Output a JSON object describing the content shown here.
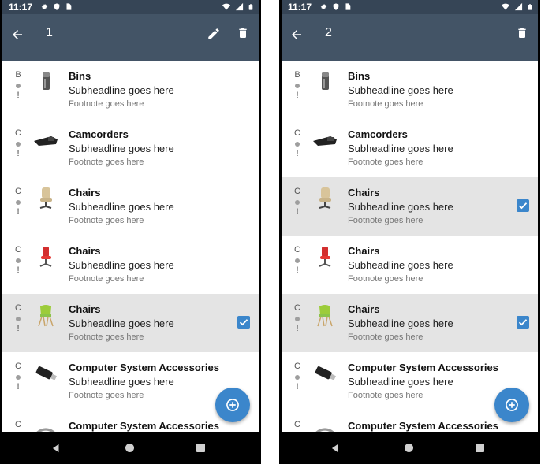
{
  "colors": {
    "appbar": "#435466",
    "statusbar": "#364556",
    "accent": "#3b86cb",
    "selected_row": "#e4e4e4"
  },
  "screens": [
    {
      "status_time": "11:17",
      "selection_count": "1",
      "actions": [
        "back-arrow-icon",
        "edit-pencil-icon",
        "delete-trash-icon"
      ],
      "items": [
        {
          "status_letter": "B",
          "status_mark": "!",
          "title": "Bins",
          "subheadline": "Subheadline goes here",
          "footnote": "Footnote goes here",
          "thumb": "bin-icon",
          "selected": false
        },
        {
          "status_letter": "C",
          "status_mark": "!",
          "title": "Camcorders",
          "subheadline": "Subheadline goes here",
          "footnote": "Footnote goes here",
          "thumb": "camcorder-icon",
          "selected": false
        },
        {
          "status_letter": "C",
          "status_mark": "!",
          "title": "Chairs",
          "subheadline": "Subheadline goes here",
          "footnote": "Footnote goes here",
          "thumb": "beige-chair-icon",
          "selected": false
        },
        {
          "status_letter": "C",
          "status_mark": "!",
          "title": "Chairs",
          "subheadline": "Subheadline goes here",
          "footnote": "Footnote goes here",
          "thumb": "red-chair-icon",
          "selected": false
        },
        {
          "status_letter": "C",
          "status_mark": "!",
          "title": "Chairs",
          "subheadline": "Subheadline goes here",
          "footnote": "Footnote goes here",
          "thumb": "green-chair-icon",
          "selected": true
        },
        {
          "status_letter": "C",
          "status_mark": "!",
          "title": "Computer System Accessories",
          "subheadline": "Subheadline goes here",
          "footnote": "Footnote goes here",
          "thumb": "usb-drive-icon",
          "selected": false
        },
        {
          "status_letter": "C",
          "status_mark": "",
          "title": "Computer System Accessories",
          "subheadline": "",
          "footnote": "",
          "thumb": "cable-icon",
          "selected": false
        }
      ]
    },
    {
      "status_time": "11:17",
      "selection_count": "2",
      "actions": [
        "back-arrow-icon",
        "delete-trash-icon"
      ],
      "items": [
        {
          "status_letter": "B",
          "status_mark": "!",
          "title": "Bins",
          "subheadline": "Subheadline goes here",
          "footnote": "Footnote goes here",
          "thumb": "bin-icon",
          "selected": false
        },
        {
          "status_letter": "C",
          "status_mark": "!",
          "title": "Camcorders",
          "subheadline": "Subheadline goes here",
          "footnote": "Footnote goes here",
          "thumb": "camcorder-icon",
          "selected": false
        },
        {
          "status_letter": "C",
          "status_mark": "!",
          "title": "Chairs",
          "subheadline": "Subheadline goes here",
          "footnote": "Footnote goes here",
          "thumb": "beige-chair-icon",
          "selected": true
        },
        {
          "status_letter": "C",
          "status_mark": "!",
          "title": "Chairs",
          "subheadline": "Subheadline goes here",
          "footnote": "Footnote goes here",
          "thumb": "red-chair-icon",
          "selected": false
        },
        {
          "status_letter": "C",
          "status_mark": "!",
          "title": "Chairs",
          "subheadline": "Subheadline goes here",
          "footnote": "Footnote goes here",
          "thumb": "green-chair-icon",
          "selected": true
        },
        {
          "status_letter": "C",
          "status_mark": "!",
          "title": "Computer System Accessories",
          "subheadline": "Subheadline goes here",
          "footnote": "Footnote goes here",
          "thumb": "usb-drive-icon",
          "selected": false
        },
        {
          "status_letter": "C",
          "status_mark": "",
          "title": "Computer System Accessories",
          "subheadline": "",
          "footnote": "",
          "thumb": "cable-icon",
          "selected": false
        }
      ]
    }
  ]
}
